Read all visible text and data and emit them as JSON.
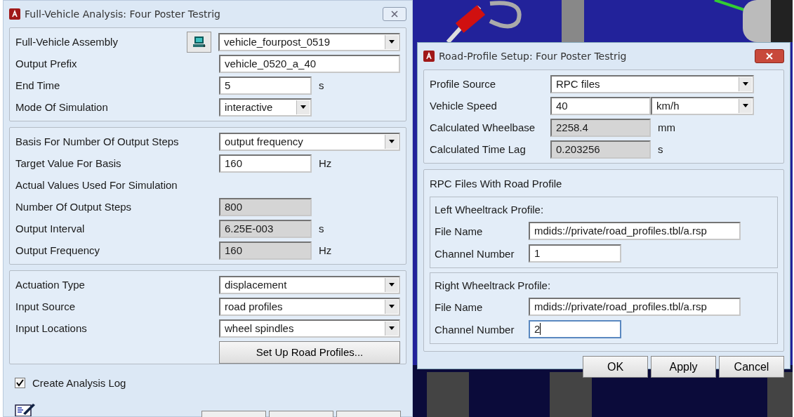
{
  "main_window": {
    "title": "Full-Vehicle Analysis: Four Poster Testrig",
    "sections": [
      {
        "rows": [
          {
            "kind": "dropdown",
            "label": "Full-Vehicle Assembly",
            "value": "vehicle_fourpost_0519",
            "browse_button": true
          },
          {
            "kind": "field",
            "label": "Output Prefix",
            "value": "vehicle_0520_a_40"
          },
          {
            "kind": "short-field",
            "label": "End Time",
            "value": "5",
            "unit": "s"
          },
          {
            "kind": "short-dropdown",
            "label": "Mode Of Simulation",
            "value": "interactive"
          }
        ]
      },
      {
        "rows": [
          {
            "kind": "dropdown",
            "label": "Basis For Number Of Output Steps",
            "value": "output frequency"
          },
          {
            "kind": "short-field",
            "label": "Target Value For Basis",
            "value": "160",
            "unit": "Hz"
          },
          {
            "kind": "heading",
            "label": "Actual Values Used For Simulation"
          },
          {
            "kind": "readonly",
            "label": "Number Of Output Steps",
            "value": "800"
          },
          {
            "kind": "readonly",
            "label": "Output Interval",
            "value": "6.25E-003",
            "unit": "s"
          },
          {
            "kind": "readonly",
            "label": "Output Frequency",
            "value": "160",
            "unit": "Hz"
          }
        ]
      },
      {
        "rows": [
          {
            "kind": "dropdown",
            "label": "Actuation Type",
            "value": "displacement"
          },
          {
            "kind": "dropdown",
            "label": "Input Source",
            "value": "road profiles"
          },
          {
            "kind": "dropdown",
            "label": "Input Locations",
            "value": "wheel spindles"
          },
          {
            "kind": "action",
            "label": "Set Up Road Profiles..."
          }
        ]
      }
    ],
    "create_log": {
      "label": "Create Analysis Log",
      "checked": true
    }
  },
  "road_profile_dialog": {
    "title": "Road-Profile Setup: Four Poster Testrig",
    "rows": [
      {
        "kind": "dropdown",
        "label": "Profile Source",
        "value": "RPC files"
      },
      {
        "kind": "field-unit-dropdown",
        "label": "Vehicle Speed",
        "value": "40",
        "unit": "km/h"
      },
      {
        "kind": "readonly",
        "label": "Calculated Wheelbase",
        "value": "2258.4",
        "unit": "mm"
      },
      {
        "kind": "readonly",
        "label": "Calculated Time Lag",
        "value": "0.203256",
        "unit": "s"
      }
    ],
    "rpc_title": "RPC Files With Road Profile",
    "groups": [
      {
        "title": "Left Wheeltrack Profile:",
        "file_label": "File Name",
        "file_value": "mdids://private/road_profiles.tbl/a.rsp",
        "channel_label": "Channel Number",
        "channel_value": "1",
        "focused": false
      },
      {
        "title": "Right Wheeltrack Profile:",
        "file_label": "File Name",
        "file_value": "mdids://private/road_profiles.tbl/a.rsp",
        "channel_label": "Channel Number",
        "channel_value": "2",
        "focused": true
      }
    ],
    "buttons": [
      "OK",
      "Apply",
      "Cancel"
    ]
  }
}
